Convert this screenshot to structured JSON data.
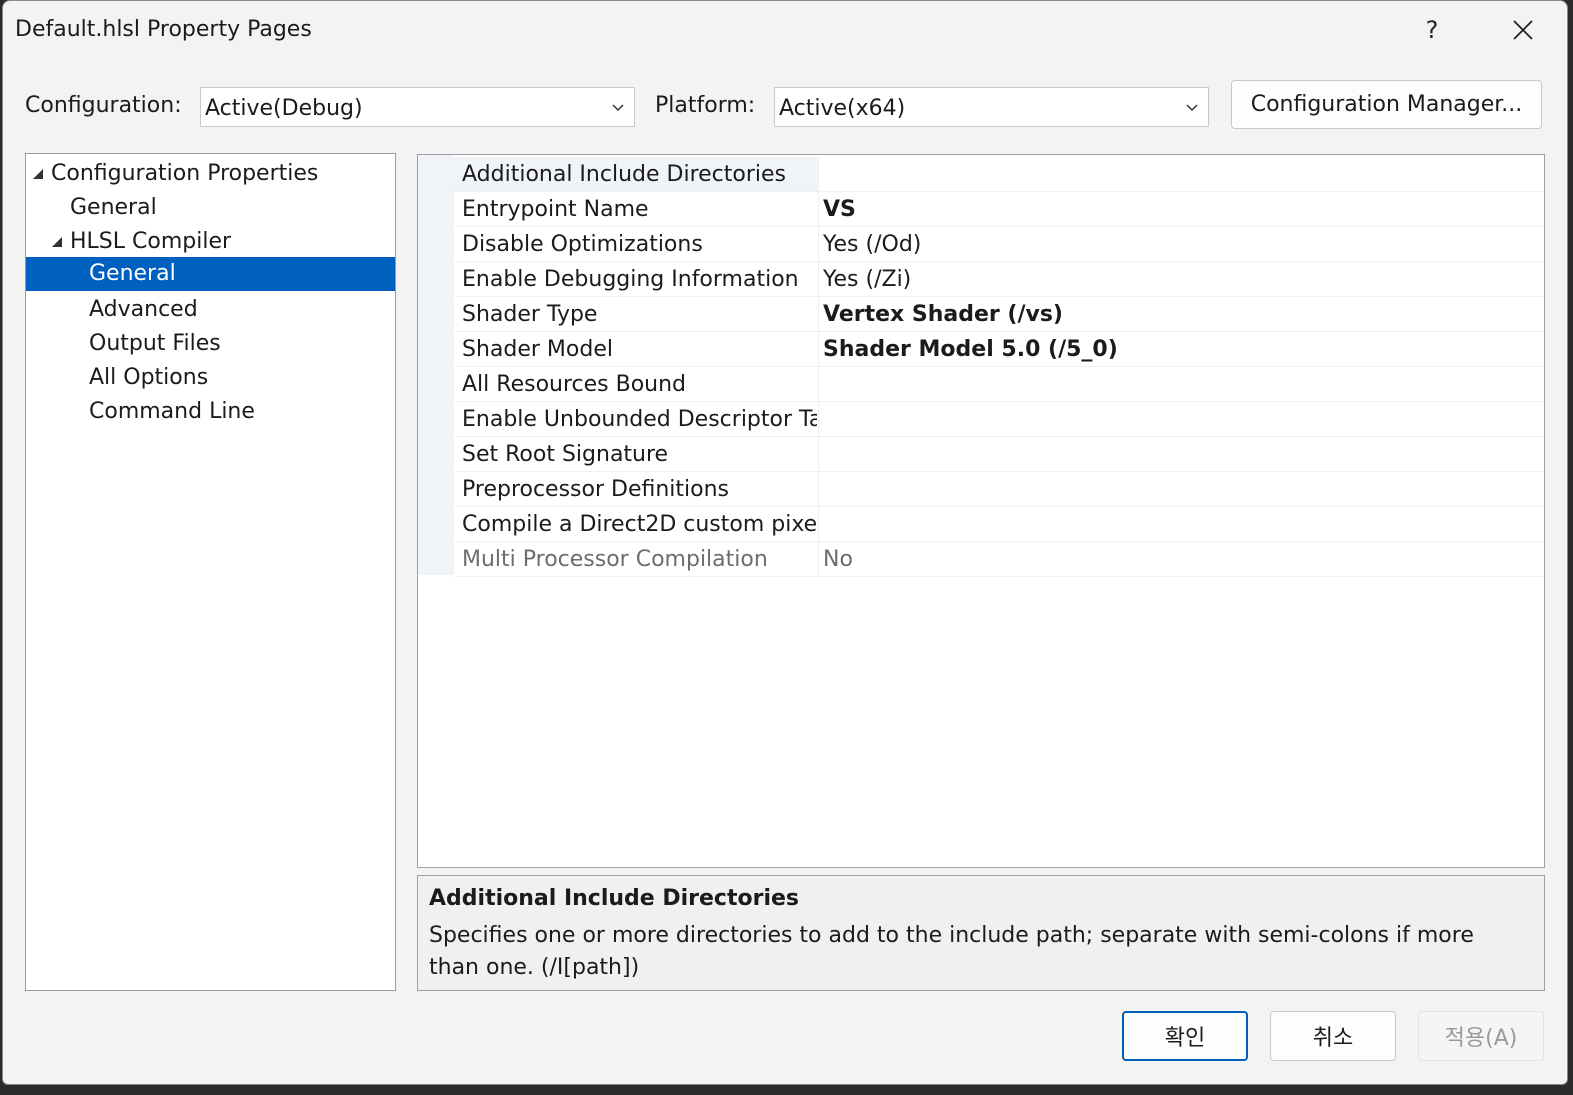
{
  "window": {
    "title": "Default.hlsl Property Pages",
    "help_label": "?"
  },
  "config_bar": {
    "configuration_label": "Configuration:",
    "configuration_value": "Active(Debug)",
    "platform_label": "Platform:",
    "platform_value": "Active(x64)",
    "manager_button": "Configuration Manager..."
  },
  "tree": {
    "items": [
      {
        "label": "Configuration Properties",
        "level": 0,
        "expanded": true
      },
      {
        "label": "General",
        "level": 1
      },
      {
        "label": "HLSL Compiler",
        "level": 1,
        "expanded": true
      },
      {
        "label": "General",
        "level": 2,
        "selected": true
      },
      {
        "label": "Advanced",
        "level": 2
      },
      {
        "label": "Output Files",
        "level": 2
      },
      {
        "label": "All Options",
        "level": 2
      },
      {
        "label": "Command Line",
        "level": 2
      }
    ]
  },
  "properties": [
    {
      "name": "Additional Include Directories",
      "value": ""
    },
    {
      "name": "Entrypoint Name",
      "value": "VS",
      "bold": true
    },
    {
      "name": "Disable Optimizations",
      "value": "Yes (/Od)"
    },
    {
      "name": "Enable Debugging Information",
      "value": "Yes (/Zi)"
    },
    {
      "name": "Shader Type",
      "value": "Vertex Shader (/vs)",
      "bold": true
    },
    {
      "name": "Shader Model",
      "value": "Shader Model 5.0 (/5_0)",
      "bold": true
    },
    {
      "name": "All Resources Bound",
      "value": ""
    },
    {
      "name": "Enable Unbounded Descriptor Ta",
      "value": ""
    },
    {
      "name": "Set Root Signature",
      "value": ""
    },
    {
      "name": "Preprocessor Definitions",
      "value": ""
    },
    {
      "name": "Compile a Direct2D custom pixel",
      "value": ""
    },
    {
      "name": "Multi Processor Compilation",
      "value": "No",
      "disabled": true
    }
  ],
  "description": {
    "title": "Additional Include Directories",
    "text": "Specifies one or more directories to add to the include path; separate with semi-colons if more than one. (/I[path])"
  },
  "buttons": {
    "ok": "확인",
    "cancel": "취소",
    "apply": "적용(A)"
  },
  "colors": {
    "selection": "#0060c0",
    "ok_border": "#005fb8"
  }
}
